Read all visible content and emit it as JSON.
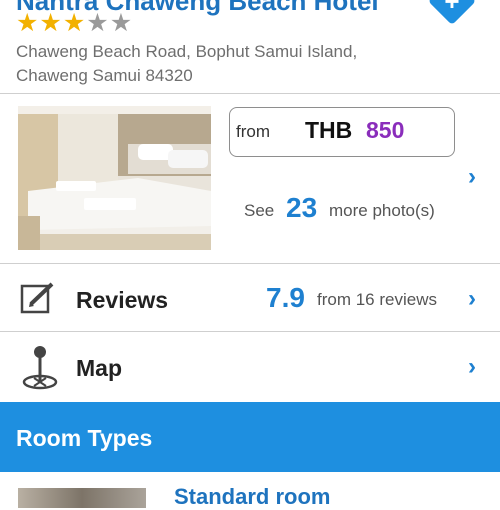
{
  "hotel": {
    "name": "Nantra Chaweng Beach Hotel",
    "stars_filled": 3,
    "stars_total": 5,
    "address_line1": "Chaweng Beach Road, Bophut Samui Island,",
    "address_line2": "Chaweng Samui 84320"
  },
  "price": {
    "from_label": "from",
    "currency": "THB",
    "amount": "850"
  },
  "photos": {
    "see_label": "See",
    "count": "23",
    "more_label": "more photo(s)"
  },
  "reviews": {
    "label": "Reviews",
    "score": "7.9",
    "count_text": "from 16 reviews"
  },
  "map": {
    "label": "Map"
  },
  "room_types": {
    "title": "Room Types",
    "first_room": "Standard room"
  },
  "colors": {
    "accent_blue": "#1e8fe0",
    "link_blue": "#1e73be",
    "price_purple": "#8a2dbb",
    "star_gold": "#f2b100"
  },
  "icons": {
    "favorite": "plus-diamond-icon",
    "reviews": "edit-icon",
    "map": "map-pin-icon",
    "chevron": "chevron-right-icon"
  }
}
